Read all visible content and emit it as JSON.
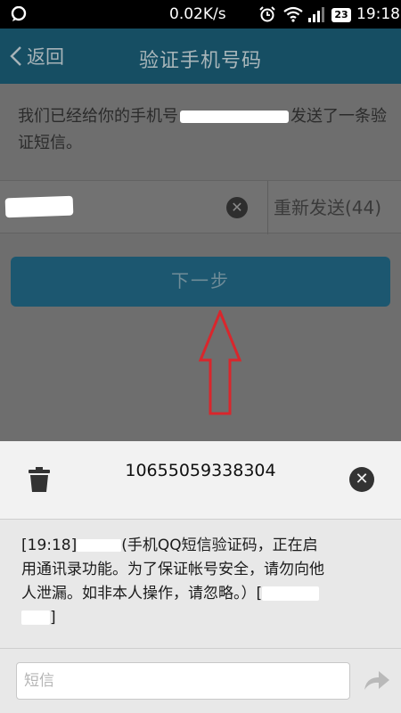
{
  "status_bar": {
    "speed": "0.02K/s",
    "battery": "23",
    "time": "19:18"
  },
  "header": {
    "back_label": "返回",
    "title": "验证手机号码"
  },
  "info": {
    "prefix": "我们已经给你的手机号",
    "suffix": "发送了一条验证短信。"
  },
  "code_row": {
    "resend_label": "重新发送(44)"
  },
  "next_button": "下一步",
  "sms": {
    "sender": "10655059338304",
    "time_tag": "[19:18]",
    "line1": "(手机QQ短信验证码，正在启",
    "line2": "用通讯录功能。为了保证帐号安全，请勿向他",
    "line3": "人泄漏。如非本人操作，请忽略。）[",
    "close_bracket": "]",
    "compose_placeholder": "短信"
  },
  "colors": {
    "header": "#164e63",
    "next_button": "#1c5770",
    "annotation_arrow": "#d9262c"
  }
}
